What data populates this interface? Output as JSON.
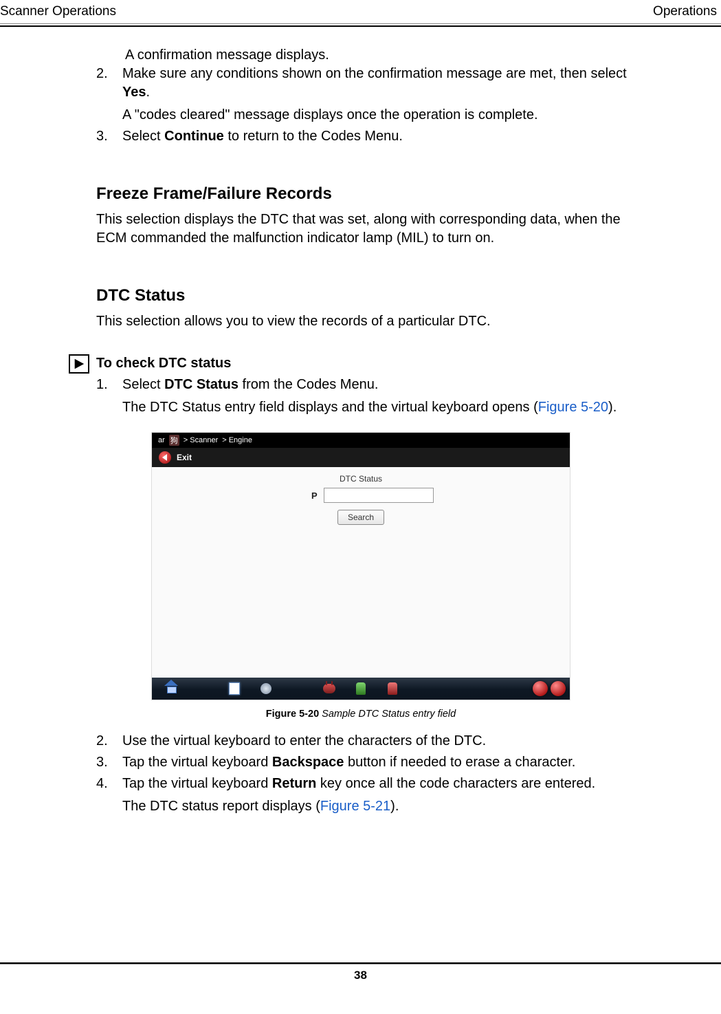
{
  "header": {
    "left": "Scanner Operations",
    "right": "Operations"
  },
  "intro": {
    "line1": " A confirmation message displays.",
    "it2": {
      "num": "2.",
      "t1": "Make sure any conditions shown on the confirmation message are met, then select ",
      "b1": "Yes",
      "t2": ".",
      "sub": "A \"codes cleared\" message displays once the operation is complete."
    },
    "it3": {
      "num": "3.",
      "t1": "Select ",
      "b1": "Continue",
      "t2": " to return to the Codes Menu."
    }
  },
  "sec1": {
    "title": "Freeze Frame/Failure Records",
    "p": "This selection displays the DTC that was set, along with corresponding data, when the ECM commanded the malfunction indicator lamp (MIL) to turn on."
  },
  "sec2": {
    "title": "DTC Status",
    "p": "This selection allows you to view the records of a particular DTC."
  },
  "proc": {
    "title": "To check DTC status",
    "s1": {
      "num": "1.",
      "t1": "Select ",
      "b1": "DTC Status",
      "t2": " from the Codes Menu.",
      "sub_t1": "The DTC Status entry field displays and the virtual keyboard opens (",
      "sub_link": "Figure 5-20",
      "sub_t2": ")."
    }
  },
  "figure": {
    "breadcrumb": {
      "p0": "ar",
      "p1": "> Scanner",
      "p2": "> Engine"
    },
    "exit": "Exit",
    "title": "DTC Status",
    "prefix": "P",
    "input_value": "",
    "search": "Search",
    "caption_label": "Figure 5-20 ",
    "caption_desc": "Sample DTC Status entry field"
  },
  "after": {
    "s2": {
      "num": "2.",
      "t": "Use the virtual keyboard to enter the characters of the DTC."
    },
    "s3": {
      "num": "3.",
      "t1": "Tap the virtual keyboard ",
      "b1": "Backspace",
      "t2": " button if needed to erase a character."
    },
    "s4": {
      "num": "4.",
      "t1": "Tap the virtual keyboard ",
      "b1": "Return",
      "t2": " key once all the code characters are entered.",
      "sub_t1": "The DTC status report displays (",
      "sub_link": "Figure 5-21",
      "sub_t2": ")."
    }
  },
  "pagenum": "38"
}
